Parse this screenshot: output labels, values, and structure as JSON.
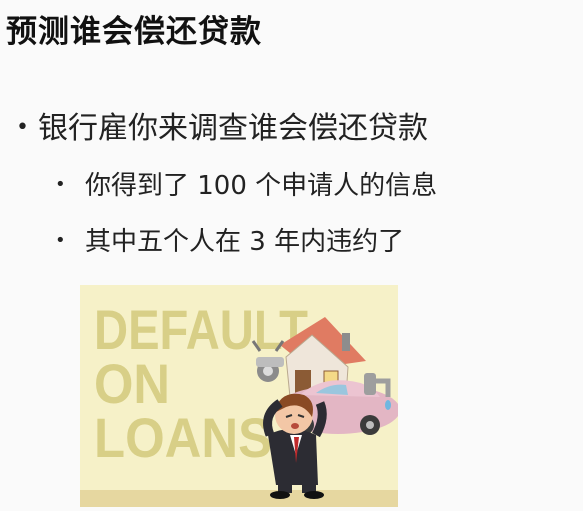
{
  "slide": {
    "title": "预测谁会偿还贷款",
    "bullet_main": "银行雇你来调查谁会偿还贷款",
    "sub_bullets": [
      "你得到了 100 个申请人的信息",
      "其中五个人在 3 年内违约了"
    ],
    "bullet_symbol": "•"
  },
  "illustration": {
    "lines": [
      "DEFAULT",
      "ON",
      "LOANS"
    ],
    "colors": {
      "background": "#f6f1c8",
      "text": "#d8cf87",
      "ground": "#e6d7a0"
    }
  }
}
